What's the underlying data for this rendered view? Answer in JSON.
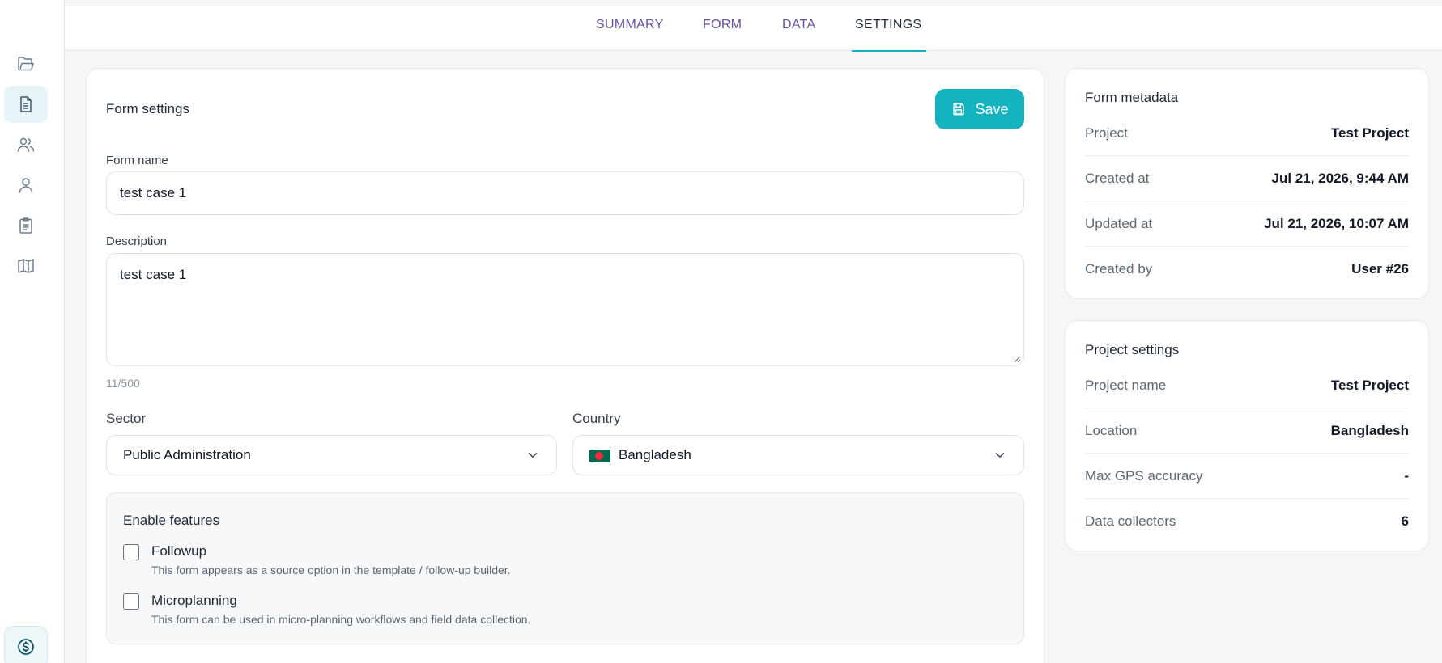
{
  "sidebar": {
    "items": [
      {
        "icon": "folder-icon"
      },
      {
        "icon": "document-icon",
        "active": true
      },
      {
        "icon": "users-icon"
      },
      {
        "icon": "user-icon"
      },
      {
        "icon": "clipboard-icon"
      },
      {
        "icon": "map-icon"
      }
    ],
    "bottom_icon": "dollar-icon"
  },
  "tabs": [
    {
      "label": "SUMMARY"
    },
    {
      "label": "FORM"
    },
    {
      "label": "DATA"
    },
    {
      "label": "SETTINGS",
      "active": true
    }
  ],
  "form_settings": {
    "title": "Form settings",
    "save_label": "Save",
    "form_name_label": "Form name",
    "form_name_value": "test case 1",
    "description_label": "Description",
    "description_value": "test case 1",
    "description_counter": "11/500",
    "sector_label": "Sector",
    "sector_value": "Public Administration",
    "country_label": "Country",
    "country_value": "Bangladesh",
    "features": {
      "title": "Enable features",
      "items": [
        {
          "name": "Followup",
          "description": "This form appears as a source option in the template / follow-up builder.",
          "checked": false
        },
        {
          "name": "Microplanning",
          "description": "This form can be used in micro-planning workflows and field data collection.",
          "checked": false
        }
      ]
    }
  },
  "form_metadata": {
    "title": "Form metadata",
    "rows": [
      {
        "key": "Project",
        "value": "Test Project"
      },
      {
        "key": "Created at",
        "value": "Jul 21, 2026, 9:44 AM"
      },
      {
        "key": "Updated at",
        "value": "Jul 21, 2026, 10:07 AM"
      },
      {
        "key": "Created by",
        "value": "User #26"
      }
    ]
  },
  "project_settings": {
    "title": "Project settings",
    "rows": [
      {
        "key": "Project name",
        "value": "Test Project"
      },
      {
        "key": "Location",
        "value": "Bangladesh"
      },
      {
        "key": "Max GPS accuracy",
        "value": "-"
      },
      {
        "key": "Data collectors",
        "value": "6"
      }
    ]
  },
  "colors": {
    "accent": "#13b3bf",
    "tab_text": "#6b4fa0",
    "page_bg": "#f4f6f8"
  }
}
